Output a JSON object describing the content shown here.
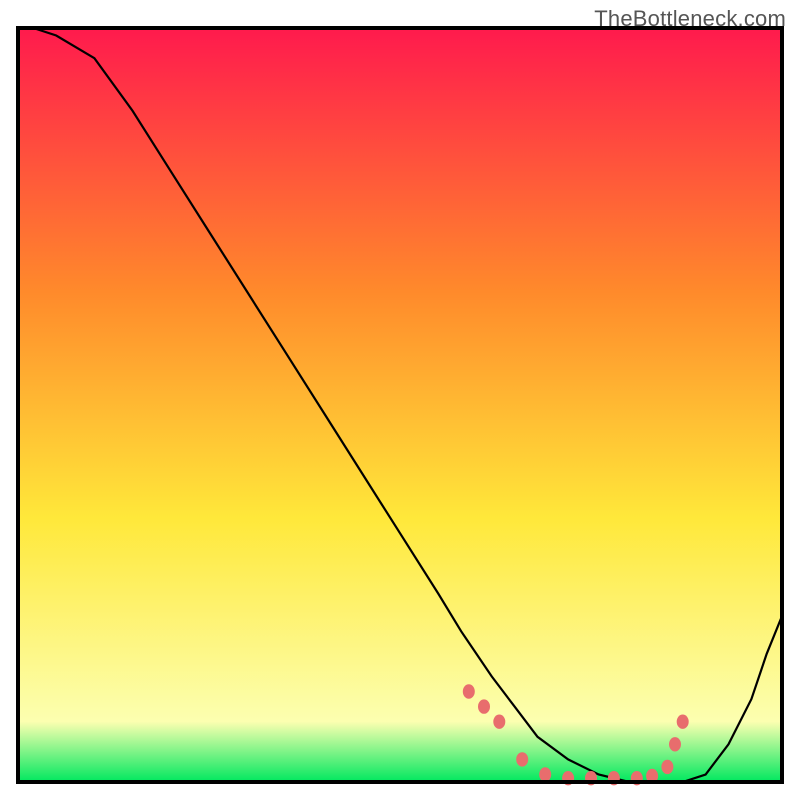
{
  "watermark": "TheBottleneck.com",
  "chart_data": {
    "type": "line",
    "title": "",
    "xlabel": "",
    "ylabel": "",
    "xlim": [
      0,
      100
    ],
    "ylim": [
      0,
      100
    ],
    "grid": false,
    "legend": false,
    "background": {
      "gradient_top": "#ff1a4d",
      "gradient_mid1": "#ff8a2b",
      "gradient_mid2": "#ffe83a",
      "gradient_light": "#fcffb0",
      "gradient_bottom": "#00e85f"
    },
    "frame_color": "#000000",
    "series": [
      {
        "name": "curve",
        "color": "#000000",
        "x": [
          2,
          5,
          10,
          15,
          20,
          25,
          30,
          35,
          40,
          45,
          50,
          55,
          58,
          62,
          65,
          68,
          72,
          76,
          80,
          84,
          87,
          90,
          93,
          96,
          98,
          100
        ],
        "y": [
          100,
          99,
          96,
          89,
          81,
          73,
          65,
          57,
          49,
          41,
          33,
          25,
          20,
          14,
          10,
          6,
          3,
          1,
          0,
          0,
          0,
          1,
          5,
          11,
          17,
          22
        ]
      }
    ],
    "markers": {
      "name": "highlight-dots",
      "color": "#e86d6d",
      "radius": 6,
      "x": [
        59,
        61,
        63,
        66,
        69,
        72,
        75,
        78,
        81,
        83,
        85,
        86,
        87
      ],
      "y": [
        12,
        10,
        8,
        3,
        1,
        0.5,
        0.5,
        0.5,
        0.5,
        0.8,
        2,
        5,
        8
      ]
    }
  }
}
